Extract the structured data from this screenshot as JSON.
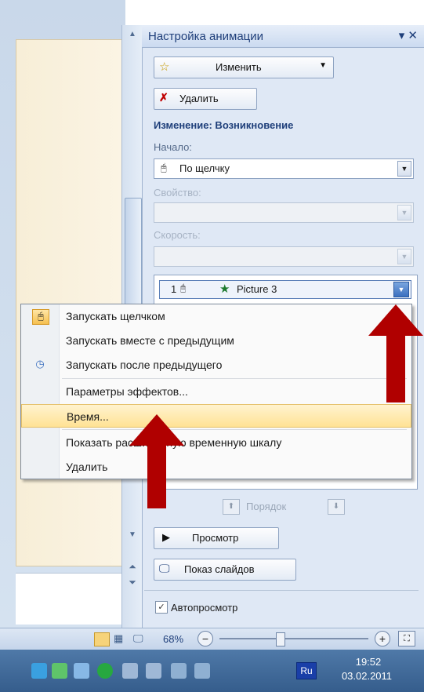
{
  "pane": {
    "title": "Настройка анимации",
    "change_button": "Изменить",
    "remove_button": "Удалить",
    "effect_heading": "Изменение: Возникновение",
    "start_label": "Начало:",
    "start_value": "По щелчку",
    "property_label": "Свойство:",
    "speed_label": "Скорость:",
    "effect_item": {
      "order": "1",
      "name": "Picture 3"
    },
    "reorder_label": "Порядок",
    "play_button": "Просмотр",
    "slideshow_button": "Показ слайдов",
    "autopreview_label": "Автопросмотр",
    "autopreview_checked": true
  },
  "context_menu": {
    "items": [
      {
        "label": "Запускать щелчком",
        "icon": "mouse-click-icon",
        "highlighted": false
      },
      {
        "label": "Запускать вместе с предыдущим",
        "icon": "",
        "highlighted": false
      },
      {
        "label": "Запускать после предыдущего",
        "icon": "clock-icon",
        "highlighted": false
      },
      {
        "label": "Параметры эффектов...",
        "icon": "",
        "highlighted": false
      },
      {
        "label": "Время...",
        "icon": "",
        "highlighted": true
      },
      {
        "label": "Показать расширенную временную шкалу",
        "icon": "",
        "highlighted": false
      },
      {
        "label": "Удалить",
        "icon": "",
        "highlighted": false
      }
    ]
  },
  "status_bar": {
    "zoom": "68%"
  },
  "taskbar": {
    "language": "Ru",
    "time": "19:52",
    "date": "03.02.2011"
  },
  "colors": {
    "annotation_arrow": "#b00000",
    "menu_highlight": "#ffe295",
    "pane_title": "#1f3f7a"
  }
}
